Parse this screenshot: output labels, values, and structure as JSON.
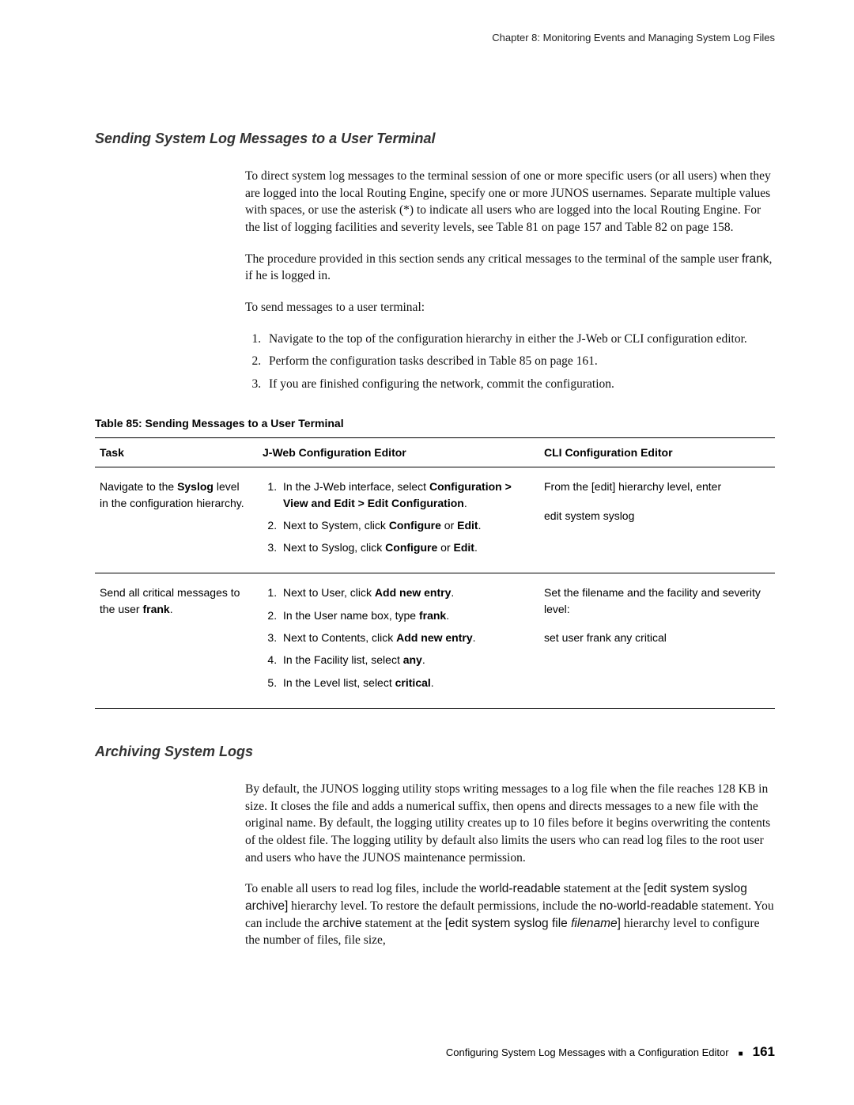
{
  "chapter_header": "Chapter 8: Monitoring Events and Managing System Log Files",
  "section1": {
    "title": "Sending System Log Messages to a User Terminal",
    "p1_prefix": "To direct system log messages to the terminal session of one or more specific users (or all users) when they are logged into the local Routing Engine, specify one or more JUNOS usernames. Separate multiple values with spaces, or use the asterisk (*) to indicate all users who are logged into the local Routing Engine. For the list of logging facilities and severity levels, see Table 81 on page 157 and Table 82 on page 158.",
    "p2_a": "The procedure provided in this section sends any critical messages to the terminal of the sample user ",
    "p2_user": "frank",
    "p2_b": ", if he is logged in.",
    "p3": "To send messages to a user terminal:",
    "steps": {
      "s1": "Navigate to the top of the configuration hierarchy in either the J-Web or CLI configuration editor.",
      "s2": "Perform the configuration tasks described in Table 85 on page 161.",
      "s3": "If you are finished configuring the network, commit the configuration."
    }
  },
  "table": {
    "title": "Table 85: Sending Messages to a User Terminal",
    "head": {
      "c1": "Task",
      "c2": "J-Web Configuration Editor",
      "c3": "CLI Configuration Editor"
    },
    "row1": {
      "task_a": "Navigate to the ",
      "task_b": "Syslog",
      "task_c": " level in the configuration hierarchy.",
      "jweb": {
        "s1a": "In the J-Web interface, select ",
        "s1b": "Configuration > View and Edit > Edit Configuration",
        "s1c": ".",
        "s2a": "Next to System, click ",
        "s2b": "Configure",
        "s2c": " or ",
        "s2d": "Edit",
        "s2e": ".",
        "s3a": "Next to Syslog, click ",
        "s3b": "Configure",
        "s3c": " or ",
        "s3d": "Edit",
        "s3e": "."
      },
      "cli_a": "From the ",
      "cli_b": "[edit]",
      "cli_c": " hierarchy level, enter",
      "cli_cmd": "edit system syslog"
    },
    "row2": {
      "task_a": "Send all ",
      "task_b": "critical",
      "task_c": " messages to the user ",
      "task_d": "frank",
      "task_e": ".",
      "jweb": {
        "s1a": "Next to User, click ",
        "s1b": "Add new entry",
        "s1c": ".",
        "s2a": "In the User name box, type ",
        "s2b": "frank",
        "s2c": ".",
        "s3a": "Next to Contents, click ",
        "s3b": "Add new entry",
        "s3c": ".",
        "s4a": "In the Facility list, select ",
        "s4b": "any",
        "s4c": ".",
        "s5a": "In the Level list, select ",
        "s5b": "critical",
        "s5c": "."
      },
      "cli_a": "Set the filename and the facility and severity level:",
      "cli_cmd": "set user frank any critical"
    }
  },
  "section2": {
    "title": "Archiving System Logs",
    "p1": "By default, the JUNOS logging utility stops writing messages to a log file when the file reaches 128 KB in size. It closes the file and adds a numerical suffix, then opens and directs messages to a new file with the original name. By default, the logging utility creates up to 10 files before it begins overwriting the contents of the oldest file. The logging utility by default also limits the users who can read log files to the root user and users who have the JUNOS maintenance permission.",
    "p2_a": "To enable all users to read log files, include the ",
    "p2_b": "world-readable",
    "p2_c": " statement at the ",
    "p2_d": "[edit system syslog archive]",
    "p2_e": " hierarchy level. To restore the default permissions, include the ",
    "p2_f": "no-world-readable",
    "p2_g": " statement. You can include the ",
    "p2_h": "archive",
    "p2_i": " statement at the ",
    "p2_j": "[edit system syslog file ",
    "p2_k": "filename",
    "p2_l": "]",
    "p2_m": " hierarchy level to configure the number of files, file size,"
  },
  "footer": {
    "text": "Configuring System Log Messages with a Configuration Editor",
    "page": "161"
  }
}
